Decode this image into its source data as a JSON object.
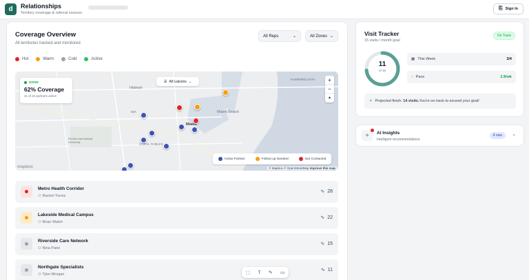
{
  "header": {
    "logo": "d",
    "title": "Relationships",
    "subtitle": "Territory coverage & referral sources",
    "signin": "Sign In"
  },
  "coverage": {
    "title": "Coverage Overview",
    "subtitle": "All territories tracked and monitored",
    "reps": "All Reps",
    "zones": "All Zones",
    "legend": [
      {
        "label": "Hot",
        "color": "#dc2626"
      },
      {
        "label": "Warm",
        "color": "#f59e0b"
      },
      {
        "label": "Cold",
        "color": "#9ca3af"
      },
      {
        "label": "Active",
        "color": "#22c55e"
      }
    ]
  },
  "map": {
    "status": "GOOD",
    "percent": "62% Coverage",
    "detail": "21 of 34 partners active",
    "liaisons": "All Liaisons",
    "labels": {
      "hialeah": "Hialeah",
      "miami_beach": "Miami Beach",
      "miami": "Miami",
      "mia": "MIA",
      "coral_gables": "CORAL GABLES",
      "fiu": "Florida International University",
      "kampong": "KAMPONG DATA"
    },
    "legend": {
      "active": "Active Partner",
      "followup": "Follow-up Needed",
      "notcontacted": "Not Contacted"
    },
    "attribution_mapbox": "© Mapbox",
    "attribution_osm": "© OpenStreetMap",
    "attribution_improve": "Improve this map",
    "mapbox_logo": "mapbox",
    "zoom_in": "+",
    "zoom_out": "−",
    "compass": "▲"
  },
  "partners": [
    {
      "name": "Metro Health Corridor",
      "person": "Rachel Torres",
      "count": "28",
      "status": "hot"
    },
    {
      "name": "Lakeside Medical Campus",
      "person": "Brian Walsh",
      "count": "22",
      "status": "warm"
    },
    {
      "name": "Riverside Care Network",
      "person": "Nina Patel",
      "count": "15",
      "status": "cold"
    },
    {
      "name": "Northgate Specialists",
      "person": "Tyler Morgan",
      "count": "11",
      "status": "cold"
    }
  ],
  "visit_tracker": {
    "title": "Visit Tracker",
    "subtitle": "15 visits / month goal",
    "badge": "On Track",
    "visits": "11",
    "of": "of 15",
    "progress": 0.733,
    "this_week_label": "This Week",
    "this_week_value": "3/4",
    "pace_label": "Pace",
    "pace_value": "2.8/wk",
    "proj_prefix": "Projected finish: ",
    "proj_bold": "14 visits.",
    "proj_suffix": "You're on track to exceed your goal!"
  },
  "ai": {
    "title": "AI Insights",
    "desc": "Intelligent recommendations",
    "badge": "4 new"
  },
  "colors": {
    "hot": "#dc2626",
    "warm": "#f59e0b",
    "cold": "#9ca3af",
    "active": "#3f51b5",
    "accent": "#1f6b5c"
  }
}
